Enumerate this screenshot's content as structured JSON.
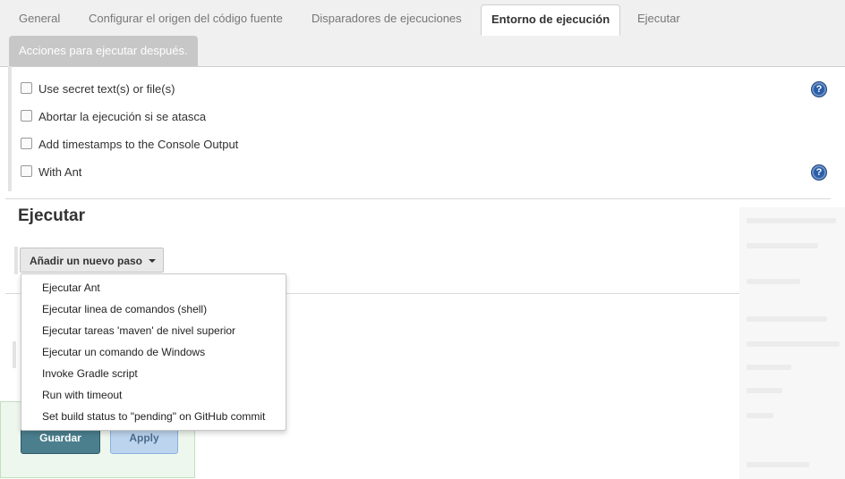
{
  "tabs": [
    {
      "label": "General",
      "active": false
    },
    {
      "label": "Configurar el origen del código fuente",
      "active": false
    },
    {
      "label": "Disparadores de ejecuciones",
      "active": false
    },
    {
      "label": "Entorno de ejecución",
      "active": true
    },
    {
      "label": "Ejecutar",
      "active": false
    },
    {
      "label": "Acciones para ejecutar después.",
      "active": false
    }
  ],
  "build_environment": {
    "options": [
      {
        "label": "Use secret text(s) or file(s)",
        "checked": false,
        "help": true
      },
      {
        "label": "Abortar la ejecución si se atasca",
        "checked": false,
        "help": false
      },
      {
        "label": "Add timestamps to the Console Output",
        "checked": false,
        "help": false
      },
      {
        "label": "With Ant",
        "checked": false,
        "help": true
      }
    ],
    "help_glyph": "?"
  },
  "build_section": {
    "title": "Ejecutar",
    "add_step_label": "Añadir un nuevo paso"
  },
  "add_step_menu": {
    "items": [
      "Ejecutar Ant",
      "Ejecutar linea de comandos (shell)",
      "Ejecutar tareas 'maven' de nivel superior",
      "Ejecutar un comando de Windows",
      "Invoke Gradle script",
      "Run with timeout",
      "Set build status to \"pending\" on GitHub commit"
    ]
  },
  "footer": {
    "save_label": "Guardar",
    "apply_label": "Apply"
  },
  "colors": {
    "save_button": "#4b7f8e",
    "apply_button": "#bcd4ee",
    "help_icon": "#2a5ea8"
  }
}
